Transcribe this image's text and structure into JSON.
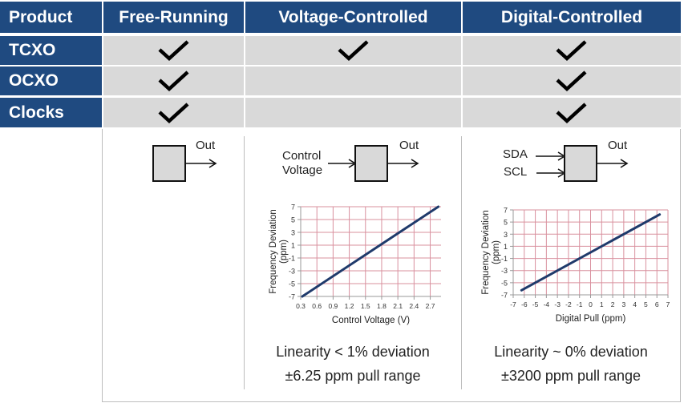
{
  "table": {
    "columns": [
      "Product",
      "Free-Running",
      "Voltage-Controlled",
      "Digital-Controlled"
    ],
    "rows": [
      {
        "label": "TCXO",
        "checks": [
          true,
          true,
          true
        ]
      },
      {
        "label": "OCXO",
        "checks": [
          true,
          false,
          true
        ]
      },
      {
        "label": "Clocks",
        "checks": [
          true,
          false,
          true
        ]
      }
    ],
    "colors": {
      "header_bg": "#1f4a80",
      "cell_bg": "#d9d9d9",
      "header_text": "#ffffff"
    }
  },
  "diagrams": {
    "free_running": {
      "output_label": "Out"
    },
    "voltage_controlled": {
      "input_label_line1": "Control",
      "input_label_line2": "Voltage",
      "output_label": "Out"
    },
    "digital_controlled": {
      "input_labels": [
        "SDA",
        "SCL"
      ],
      "output_label": "Out"
    }
  },
  "captions": {
    "voltage_controlled": {
      "line1": "Linearity < 1% deviation",
      "line2": "±6.25 ppm pull range"
    },
    "digital_controlled": {
      "line1": "Linearity ~ 0% deviation",
      "line2": "±3200 ppm pull range"
    }
  },
  "chart_data": [
    {
      "type": "line",
      "title": "",
      "xlabel": "Control Voltage (V)",
      "ylabel": "Frequency Deviation (ppm)",
      "xlim": [
        0.3,
        2.9
      ],
      "ylim": [
        -7,
        7
      ],
      "x_ticks": [
        "0.3",
        "0.6",
        "0.9",
        "1.2",
        "1.5",
        "1.8",
        "2.1",
        "2.4",
        "2.7"
      ],
      "y_ticks": [
        "7",
        "5",
        "3",
        "1",
        "-1",
        "-3",
        "-5",
        "-7"
      ],
      "grid": true,
      "grid_color": "#d9909e",
      "line_color": "#1f3a6b",
      "series": [
        {
          "name": "deviation",
          "x": [
            0.33,
            2.85
          ],
          "y": [
            -7,
            7
          ]
        }
      ]
    },
    {
      "type": "line",
      "title": "",
      "xlabel": "Digital Pull (ppm)",
      "ylabel": "Frequency Deviation (ppm)",
      "xlim": [
        -7,
        7
      ],
      "ylim": [
        -7,
        7
      ],
      "x_ticks": [
        "-7",
        "-6",
        "-5",
        "-4",
        "-3",
        "-2",
        "-1",
        "0",
        "1",
        "2",
        "3",
        "4",
        "5",
        "6",
        "7"
      ],
      "y_ticks": [
        "7",
        "5",
        "3",
        "1",
        "-1",
        "-3",
        "-5",
        "-7"
      ],
      "grid": true,
      "grid_color": "#d9909e",
      "line_color": "#1f3a6b",
      "series": [
        {
          "name": "deviation",
          "x": [
            -6.25,
            6.25
          ],
          "y": [
            -6.25,
            6.25
          ]
        }
      ]
    }
  ]
}
